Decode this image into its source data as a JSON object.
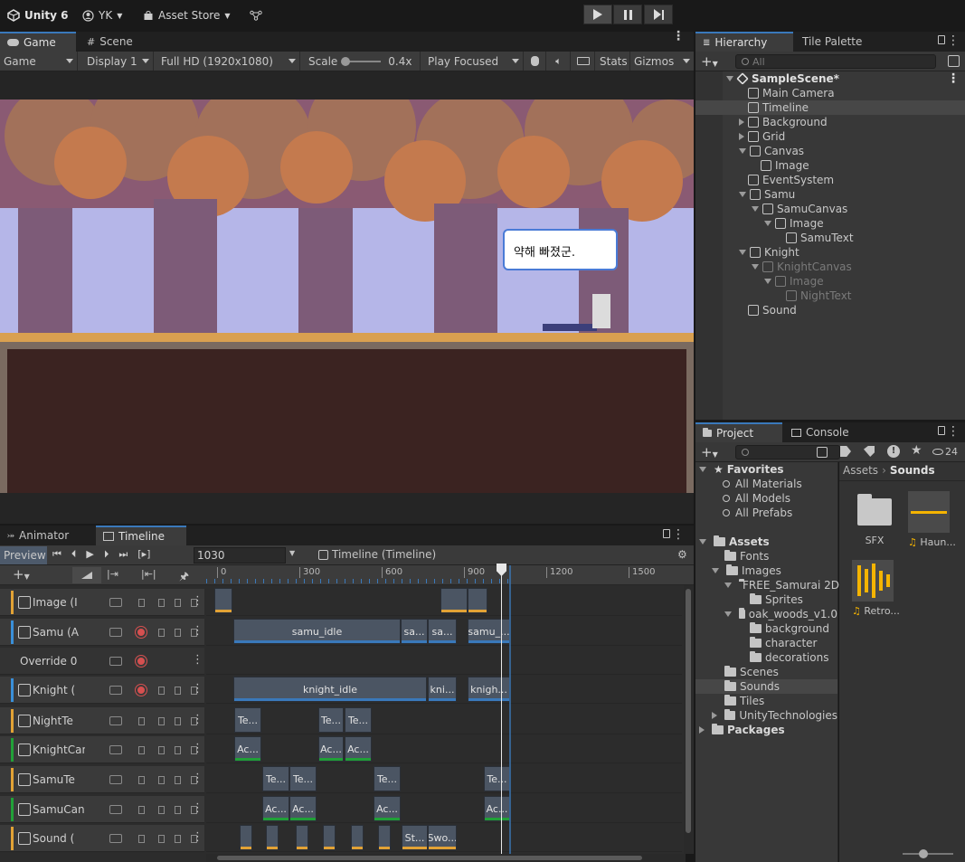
{
  "topbar": {
    "product": "Unity 6",
    "account": "YK",
    "asset_store": "Asset Store"
  },
  "game": {
    "tabs": [
      "Game",
      "Scene"
    ],
    "display_mode": "Game",
    "display": "Display 1",
    "resolution": "Full HD (1920x1080)",
    "scale_label": "Scale",
    "scale_value": "0.4x",
    "play_mode": "Play Focused",
    "stats": "Stats",
    "gizmos": "Gizmos",
    "speech_text": "약해 빠졌군."
  },
  "hierarchy": {
    "tabs": [
      "Hierarchy",
      "Tile Palette"
    ],
    "search_placeholder": "All",
    "scene_name": "SampleScene*",
    "items": [
      {
        "label": "Main Camera",
        "depth": 1,
        "arrow": "none",
        "dim": false,
        "selected": false
      },
      {
        "label": "Timeline",
        "depth": 1,
        "arrow": "none",
        "dim": false,
        "selected": true
      },
      {
        "label": "Background",
        "depth": 1,
        "arrow": "right",
        "dim": false,
        "selected": false
      },
      {
        "label": "Grid",
        "depth": 1,
        "arrow": "right",
        "dim": false,
        "selected": false
      },
      {
        "label": "Canvas",
        "depth": 1,
        "arrow": "down",
        "dim": false,
        "selected": false
      },
      {
        "label": "Image",
        "depth": 2,
        "arrow": "none",
        "dim": false,
        "selected": false
      },
      {
        "label": "EventSystem",
        "depth": 1,
        "arrow": "none",
        "dim": false,
        "selected": false
      },
      {
        "label": "Samu",
        "depth": 1,
        "arrow": "down",
        "dim": false,
        "selected": false
      },
      {
        "label": "SamuCanvas",
        "depth": 2,
        "arrow": "down",
        "dim": false,
        "selected": false
      },
      {
        "label": "Image",
        "depth": 3,
        "arrow": "down",
        "dim": false,
        "selected": false
      },
      {
        "label": "SamuText",
        "depth": 4,
        "arrow": "none",
        "dim": false,
        "selected": false
      },
      {
        "label": "Knight",
        "depth": 1,
        "arrow": "down",
        "dim": false,
        "selected": false
      },
      {
        "label": "KnightCanvas",
        "depth": 2,
        "arrow": "down",
        "dim": true,
        "selected": false
      },
      {
        "label": "Image",
        "depth": 3,
        "arrow": "down",
        "dim": true,
        "selected": false
      },
      {
        "label": "NightText",
        "depth": 4,
        "arrow": "none",
        "dim": true,
        "selected": false
      },
      {
        "label": "Sound",
        "depth": 1,
        "arrow": "none",
        "dim": false,
        "selected": false
      }
    ]
  },
  "project": {
    "tabs": [
      "Project",
      "Console"
    ],
    "hidden_count": "24",
    "favorites_label": "Favorites",
    "favorites": [
      "All Materials",
      "All Models",
      "All Prefabs"
    ],
    "tree": [
      {
        "label": "Assets",
        "depth": 0,
        "arrow": "down",
        "bold": true
      },
      {
        "label": "Fonts",
        "depth": 1,
        "arrow": "none",
        "bold": false
      },
      {
        "label": "Images",
        "depth": 1,
        "arrow": "down",
        "bold": false
      },
      {
        "label": "FREE_Samurai 2D",
        "depth": 2,
        "arrow": "down",
        "bold": false
      },
      {
        "label": "Sprites",
        "depth": 3,
        "arrow": "none",
        "bold": false
      },
      {
        "label": "oak_woods_v1.0",
        "depth": 2,
        "arrow": "down",
        "bold": false
      },
      {
        "label": "background",
        "depth": 3,
        "arrow": "none",
        "bold": false
      },
      {
        "label": "character",
        "depth": 3,
        "arrow": "none",
        "bold": false
      },
      {
        "label": "decorations",
        "depth": 3,
        "arrow": "none",
        "bold": false
      },
      {
        "label": "Scenes",
        "depth": 1,
        "arrow": "none",
        "bold": false
      },
      {
        "label": "Sounds",
        "depth": 1,
        "arrow": "none",
        "bold": false,
        "selected": true
      },
      {
        "label": "Tiles",
        "depth": 1,
        "arrow": "none",
        "bold": false
      },
      {
        "label": "UnityTechnologies",
        "depth": 1,
        "arrow": "right",
        "bold": false
      },
      {
        "label": "Packages",
        "depth": 0,
        "arrow": "right",
        "bold": true
      }
    ],
    "breadcrumb": [
      "Assets",
      "Sounds"
    ],
    "assets": [
      {
        "label": "SFX",
        "kind": "folder"
      },
      {
        "label": "Haun...",
        "kind": "audio"
      },
      {
        "label": "Retro...",
        "kind": "audio"
      }
    ]
  },
  "timeline": {
    "tabs": [
      "Animator",
      "Timeline"
    ],
    "preview_label": "Preview",
    "frame": "1030",
    "asset_name": "Timeline (Timeline)",
    "ruler_ticks": [
      "0",
      "300",
      "600",
      "900",
      "1200",
      "1500"
    ],
    "tracks": [
      {
        "name": "Image (I",
        "color": "#e2a235"
      },
      {
        "name": "Samu (A",
        "color": "#3a8fd8"
      },
      {
        "name": "Override 0",
        "color": ""
      },
      {
        "name": "Knight (",
        "color": "#3a8fd8"
      },
      {
        "name": "NightTe",
        "color": "#e2a235"
      },
      {
        "name": "KnightCanva",
        "color": "#21a038"
      },
      {
        "name": "SamuTe",
        "color": "#e2a235"
      },
      {
        "name": "SamuCanvas",
        "color": "#21a038"
      },
      {
        "name": "Sound (",
        "color": "#e2a235"
      }
    ],
    "clips": {
      "samu": [
        "samu_idle",
        "sa...",
        "sa...",
        "samu_..."
      ],
      "knight": [
        "knight_idle",
        "kni...",
        "knigh..."
      ],
      "nighttext": [
        "Te...",
        "Te...",
        "Te..."
      ],
      "knightcanvas": [
        "Ac...",
        "Ac...",
        "Ac..."
      ],
      "samutext": [
        "Te...",
        "Te...",
        "Te...",
        "Te..."
      ],
      "samucanvas": [
        "Ac...",
        "Ac...",
        "Ac...",
        "Ac..."
      ],
      "sound": [
        "St...",
        "Swo..."
      ]
    }
  }
}
